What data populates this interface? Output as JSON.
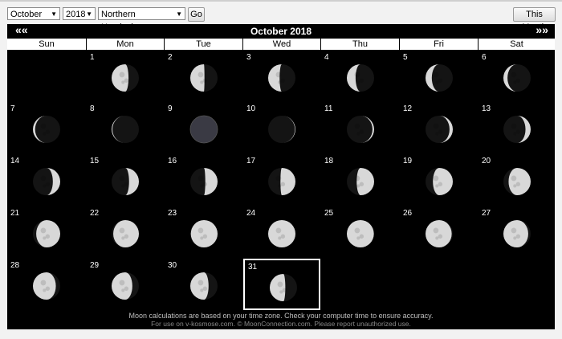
{
  "toolbar": {
    "month": "October",
    "year": "2018",
    "hemisphere": "Northern Hemisphere",
    "go_label": "Go",
    "this_month_label": "This Month"
  },
  "calendar": {
    "title": "October 2018",
    "prev_label": "««",
    "next_label": "»»",
    "days": [
      "Sun",
      "Mon",
      "Tue",
      "Wed",
      "Thu",
      "Fri",
      "Sat"
    ],
    "first_weekday": 1,
    "num_days": 31,
    "today": 31,
    "phases": [
      {
        "day": 1,
        "illumination": 0.62,
        "waxing": false
      },
      {
        "day": 2,
        "illumination": 0.52,
        "waxing": false
      },
      {
        "day": 3,
        "illumination": 0.42,
        "waxing": false
      },
      {
        "day": 4,
        "illumination": 0.32,
        "waxing": false
      },
      {
        "day": 5,
        "illumination": 0.23,
        "waxing": false
      },
      {
        "day": 6,
        "illumination": 0.15,
        "waxing": false
      },
      {
        "day": 7,
        "illumination": 0.08,
        "waxing": false
      },
      {
        "day": 8,
        "illumination": 0.03,
        "waxing": false
      },
      {
        "day": 9,
        "illumination": 0.0,
        "waxing": true
      },
      {
        "day": 10,
        "illumination": 0.02,
        "waxing": true
      },
      {
        "day": 11,
        "illumination": 0.06,
        "waxing": true
      },
      {
        "day": 12,
        "illumination": 0.12,
        "waxing": true
      },
      {
        "day": 13,
        "illumination": 0.19,
        "waxing": true
      },
      {
        "day": 14,
        "illumination": 0.27,
        "waxing": true
      },
      {
        "day": 15,
        "illumination": 0.36,
        "waxing": true
      },
      {
        "day": 16,
        "illumination": 0.45,
        "waxing": true
      },
      {
        "day": 17,
        "illumination": 0.55,
        "waxing": true
      },
      {
        "day": 18,
        "illumination": 0.64,
        "waxing": true
      },
      {
        "day": 19,
        "illumination": 0.73,
        "waxing": true
      },
      {
        "day": 20,
        "illumination": 0.81,
        "waxing": true
      },
      {
        "day": 21,
        "illumination": 0.88,
        "waxing": true
      },
      {
        "day": 22,
        "illumination": 0.94,
        "waxing": true
      },
      {
        "day": 23,
        "illumination": 0.98,
        "waxing": true
      },
      {
        "day": 24,
        "illumination": 1.0,
        "waxing": true
      },
      {
        "day": 25,
        "illumination": 0.99,
        "waxing": false
      },
      {
        "day": 26,
        "illumination": 0.96,
        "waxing": false
      },
      {
        "day": 27,
        "illumination": 0.91,
        "waxing": false
      },
      {
        "day": 28,
        "illumination": 0.84,
        "waxing": false
      },
      {
        "day": 29,
        "illumination": 0.76,
        "waxing": false
      },
      {
        "day": 30,
        "illumination": 0.67,
        "waxing": false
      },
      {
        "day": 31,
        "illumination": 0.57,
        "waxing": false
      }
    ]
  },
  "footer": {
    "line1": "Moon calculations are based on your time zone. Check your computer time to ensure accuracy.",
    "line2": "For use on v-kosmose.com. © MoonConnection.com. Please report unauthorized use."
  },
  "colors": {
    "background": "#f2f2f2",
    "calendar_bg": "#000000",
    "moon_light": "#d8d8d8",
    "moon_dark": "#141414",
    "new_moon": "#3a3a44"
  },
  "icons": {
    "dropdown": "chevron-down-icon",
    "moon": "moon-phase-icon"
  }
}
